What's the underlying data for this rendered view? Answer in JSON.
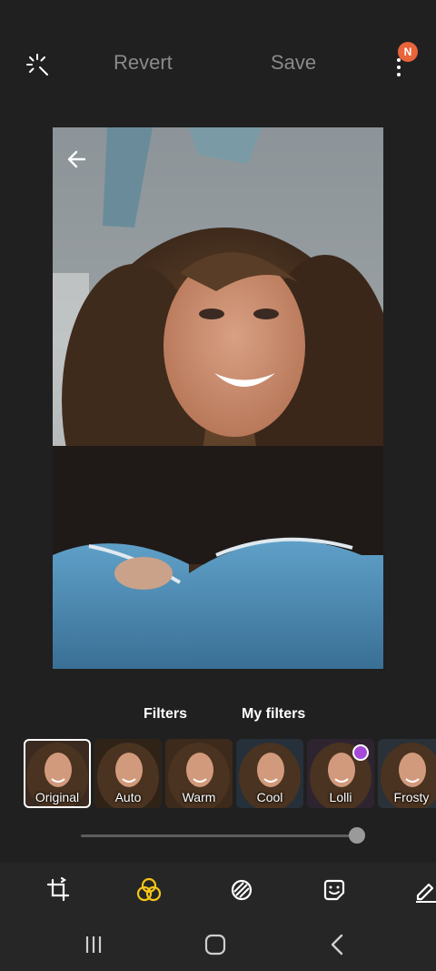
{
  "header": {
    "revert_label": "Revert",
    "save_label": "Save",
    "badge_text": "N",
    "auto_icon": "sparkle-icon",
    "more_icon": "more-vert-icon"
  },
  "tabs": [
    {
      "label": "Filters"
    },
    {
      "label": "My filters"
    }
  ],
  "filters": [
    {
      "label": "Original",
      "selected": true
    },
    {
      "label": "Auto"
    },
    {
      "label": "Warm"
    },
    {
      "label": "Cool"
    },
    {
      "label": "Lolli"
    },
    {
      "label": "Frosty"
    }
  ],
  "filter_strength": 1.0,
  "toolbar_icons": [
    "crop-rotate-icon",
    "filter-icon",
    "tone-icon",
    "sticker-icon",
    "draw-icon"
  ],
  "colors": {
    "background": "#202020",
    "active_tool": "#f5c518",
    "badge": "#e8643a"
  }
}
